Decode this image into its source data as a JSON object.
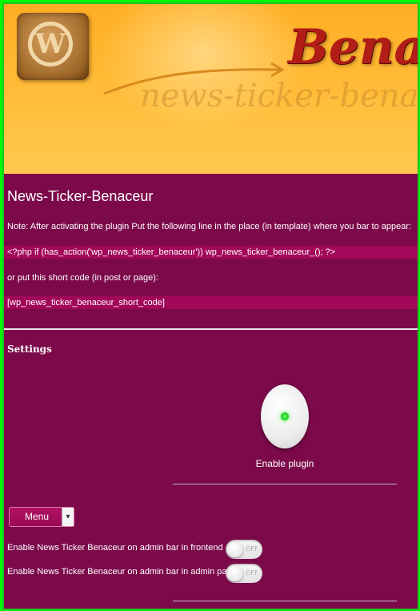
{
  "banner": {
    "title": "Benac",
    "shadow_text": "news-ticker-bena",
    "logo_glyph": "W"
  },
  "page": {
    "title": "News-Ticker-Benaceur",
    "note": "Note: After activating the plugin Put the following line in the place (in template) where you bar to appear:",
    "php_code": "<?php if (has_action('wp_news_ticker_benaceur')) wp_news_ticker_benaceur_(); ?>",
    "shortcode_intro": "or put this short code (in post or page):",
    "shortcode": "[wp_news_ticker_benaceur_short_code]"
  },
  "settings": {
    "heading": "Settings",
    "enable_plugin": {
      "label": "Enable plugin",
      "state": "on"
    },
    "menu": {
      "selected": "Menu",
      "caret_icon": "chevron-down-icon"
    },
    "options": [
      {
        "label": "Enable News Ticker Benaceur on admin bar in frontend",
        "switch_text": "OFF"
      },
      {
        "label": "Enable News Ticker Benaceur on admin bar in admin panel",
        "switch_text": "OFF"
      }
    ]
  },
  "colors": {
    "background": "#7c0a4b",
    "code_highlight": "#a2085a",
    "banner": "#ffb42e",
    "frame": "#00ff00"
  }
}
